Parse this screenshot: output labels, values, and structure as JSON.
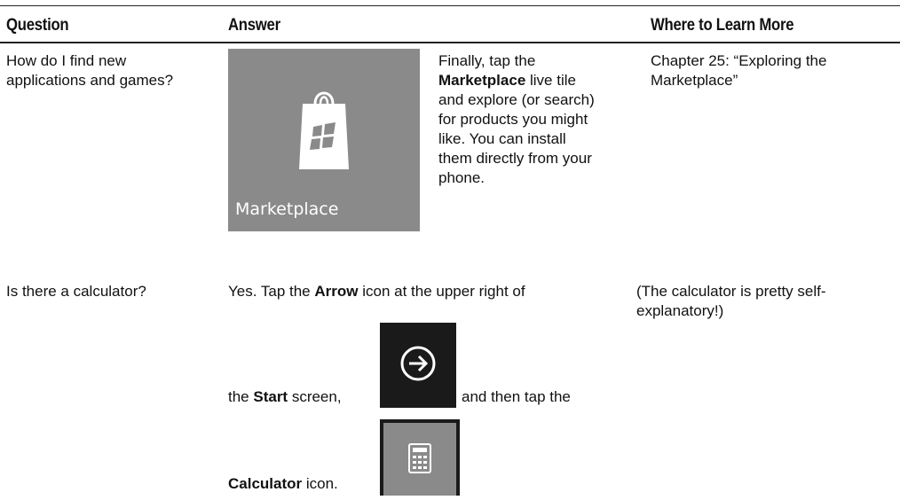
{
  "table": {
    "headers": {
      "question": "Question",
      "answer": "Answer",
      "learn_more": "Where to Learn More"
    },
    "row1": {
      "question": "How do I find new applications and games?",
      "answer_pre": "Finally, tap the ",
      "answer_bold": "Marketplace",
      "answer_post": " live tile and explore (or search) for products you might like. You can install them directly from your phone.",
      "tile_label": "Marketplace",
      "learn_more": "Chapter 25: “Exploring the Marketplace”"
    },
    "row2": {
      "question": "Is there a calculator?",
      "line1_pre": "Yes. Tap the ",
      "line1_bold": "Arrow",
      "line1_post": " icon at the upper right of",
      "line2_pre": "the ",
      "line2_bold": "Start",
      "line2_post": " screen,",
      "line2_after": "and then tap the",
      "line3_bold": "Calculator",
      "line3_post": " icon.",
      "learn_more": "(The calculator is pretty self-explanatory!)"
    }
  },
  "icons": {
    "marketplace": "shopping-bag-windows-icon",
    "arrow": "arrow-circle-icon",
    "calculator": "calculator-icon"
  },
  "colors": {
    "tile_gray": "#8a8a8a",
    "tile_dark": "#1a1a1a"
  }
}
